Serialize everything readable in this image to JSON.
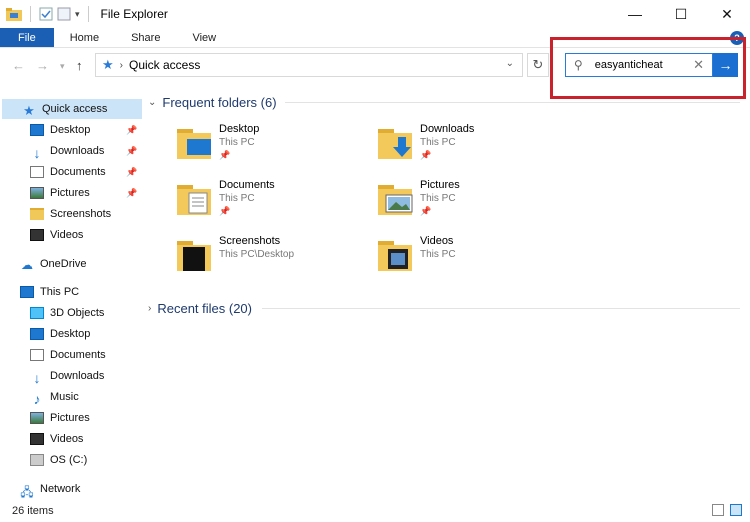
{
  "window": {
    "title": "File Explorer",
    "controls": {
      "minimize": "—",
      "maximize": "☐",
      "close": "✕"
    }
  },
  "ribbon": {
    "tabs": [
      "File",
      "Home",
      "Share",
      "View"
    ],
    "help": "?"
  },
  "address": {
    "location": "Quick access",
    "search_value": "easyanticheat",
    "accent": "#1a6fd0",
    "highlight_color": "#c9222c"
  },
  "sidebar": {
    "quick_access": {
      "label": "Quick access",
      "items": [
        {
          "label": "Desktop",
          "icon": "desktop-icon",
          "pinned": true
        },
        {
          "label": "Downloads",
          "icon": "download-icon",
          "pinned": true
        },
        {
          "label": "Documents",
          "icon": "document-icon",
          "pinned": true
        },
        {
          "label": "Pictures",
          "icon": "picture-icon",
          "pinned": true
        },
        {
          "label": "Screenshots",
          "icon": "folder-icon",
          "pinned": false
        },
        {
          "label": "Videos",
          "icon": "video-icon",
          "pinned": false
        }
      ]
    },
    "onedrive": "OneDrive",
    "this_pc": {
      "label": "This PC",
      "items": [
        {
          "label": "3D Objects",
          "icon": "cube-icon"
        },
        {
          "label": "Desktop",
          "icon": "desktop-icon"
        },
        {
          "label": "Documents",
          "icon": "document-icon"
        },
        {
          "label": "Downloads",
          "icon": "download-icon"
        },
        {
          "label": "Music",
          "icon": "music-icon"
        },
        {
          "label": "Pictures",
          "icon": "picture-icon"
        },
        {
          "label": "Videos",
          "icon": "video-icon"
        },
        {
          "label": "OS (C:)",
          "icon": "drive-icon"
        }
      ]
    },
    "network": "Network"
  },
  "main": {
    "frequent_header": "Frequent folders (6)",
    "recent_header": "Recent files (20)",
    "folders": [
      {
        "name": "Desktop",
        "location": "This PC",
        "pinned": true
      },
      {
        "name": "Downloads",
        "location": "This PC",
        "pinned": true
      },
      {
        "name": "Documents",
        "location": "This PC",
        "pinned": true
      },
      {
        "name": "Pictures",
        "location": "This PC",
        "pinned": true
      },
      {
        "name": "Screenshots",
        "location": "This PC\\Desktop",
        "pinned": false
      },
      {
        "name": "Videos",
        "location": "This PC",
        "pinned": false
      }
    ]
  },
  "status": {
    "item_count": "26 items"
  }
}
